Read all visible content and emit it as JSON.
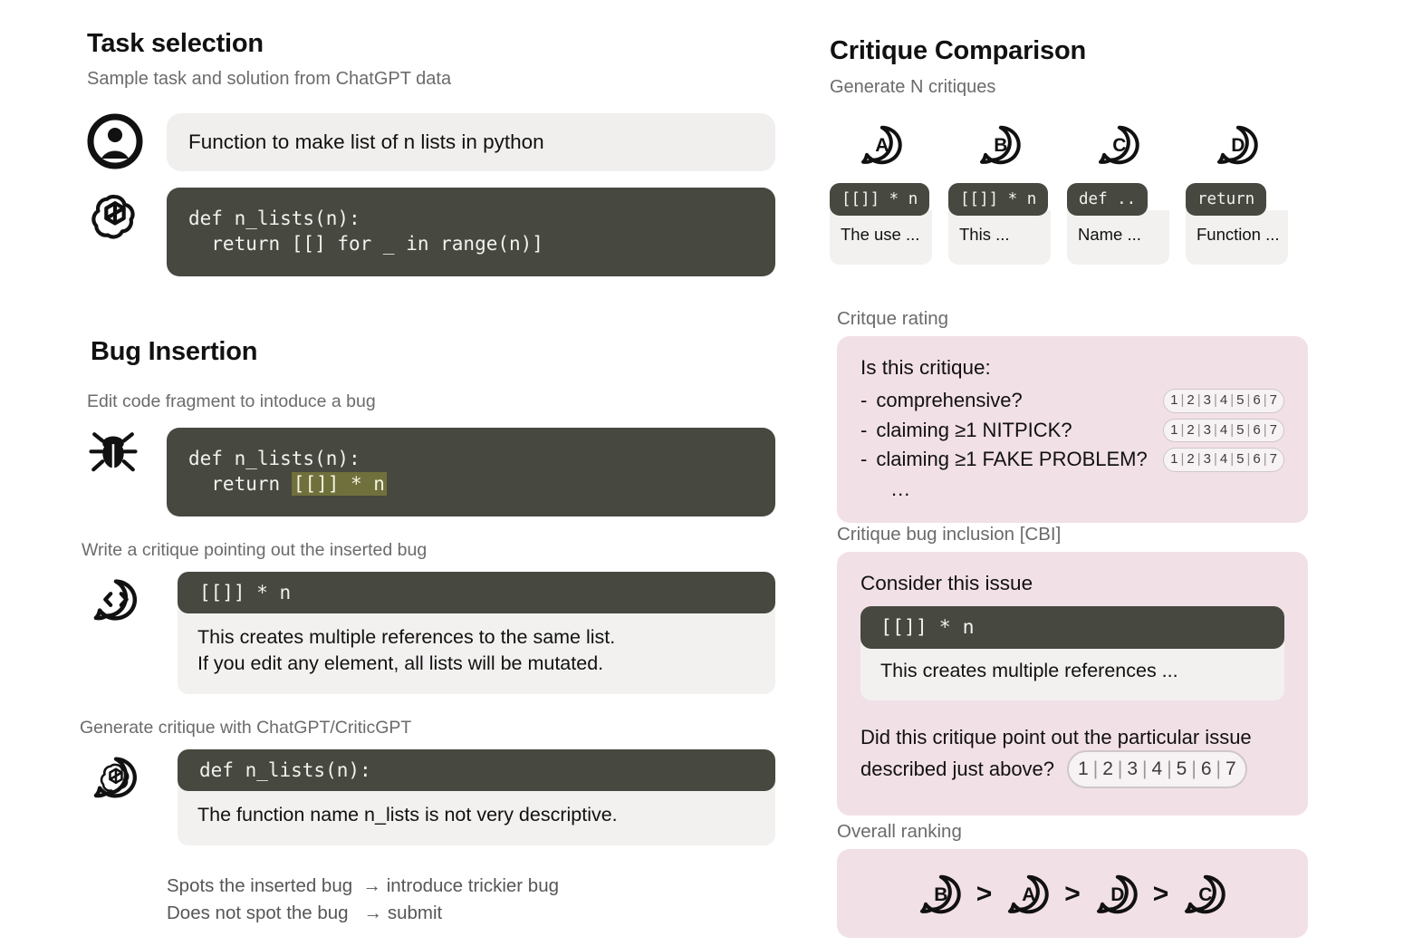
{
  "left": {
    "task_selection": {
      "title": "Task selection",
      "subtitle": "Sample task and solution from ChatGPT data",
      "user_icon": "user-avatar-icon",
      "user_prompt": "Function to make list of n lists in python",
      "assistant_icon": "openai-logo-icon",
      "assistant_code": "def n_lists(n):\n  return [[] for _ in range(n)]"
    },
    "bug_insertion": {
      "title": "Bug Insertion",
      "step1_label": "Edit code fragment to intoduce a bug",
      "bug_icon": "bug-icon",
      "buggy_code_prefix": "def n_lists(n):\n  return ",
      "buggy_code_highlight": "[[]] * n",
      "step2_label": "Write a critique pointing out the inserted bug",
      "critique_icon": "code-speech-bubble-icon",
      "human_critique_code": "[[]] * n",
      "human_critique_text": "This creates multiple references to the same list.\nIf you edit any element, all lists will be mutated.",
      "step3_label": "Generate critique with ChatGPT/CriticGPT",
      "model_icon": "openai-speech-bubble-icon",
      "model_critique_code": "def n_lists(n):",
      "model_critique_text": "The function name n_lists is not very descriptive.",
      "outcome_line1": "Spots the inserted bug  → introduce trickier bug",
      "outcome_line2": "Does not spot the bug   → submit"
    }
  },
  "right": {
    "title": "Critique Comparison",
    "subtitle": "Generate N critiques",
    "critiques": [
      {
        "letter": "A",
        "icon": "speech-bubble-a-icon",
        "code": "[[]] * n",
        "text": "The use ..."
      },
      {
        "letter": "B",
        "icon": "speech-bubble-b-icon",
        "code": "[[]] * n",
        "text": "This ..."
      },
      {
        "letter": "C",
        "icon": "speech-bubble-c-icon",
        "code": "def ..",
        "text": "Name ..."
      },
      {
        "letter": "D",
        "icon": "speech-bubble-d-icon",
        "code": "return",
        "text": "Function ..."
      }
    ],
    "critique_rating": {
      "label": "Critque rating",
      "heading": "Is this critique:",
      "items": [
        {
          "dash": "-",
          "question": "comprehensive?"
        },
        {
          "dash": "-",
          "question": "claiming ≥1 NITPICK?"
        },
        {
          "dash": "-",
          "question": "claiming ≥1 FAKE PROBLEM?"
        }
      ],
      "scale": [
        "1",
        "2",
        "3",
        "4",
        "5",
        "6",
        "7"
      ],
      "more": "..."
    },
    "cbi": {
      "label": "Critique bug inclusion [CBI]",
      "heading": "Consider this issue",
      "code": "[[]] * n",
      "text": "This creates multiple references ...",
      "question_line1": "Did this critique point out the particular issue",
      "question_line2": "described just above?",
      "scale": [
        "1",
        "2",
        "3",
        "4",
        "5",
        "6",
        "7"
      ]
    },
    "overall_ranking": {
      "label": "Overall ranking",
      "order": [
        "B",
        "A",
        "D",
        "C"
      ],
      "separator": ">"
    }
  },
  "colors": {
    "code_bg": "#474840",
    "highlight_bg": "#70703c",
    "card_bg": "#f2f1f0",
    "panel_pink": "#f2e0e7",
    "muted_text": "#6b6b6b"
  }
}
